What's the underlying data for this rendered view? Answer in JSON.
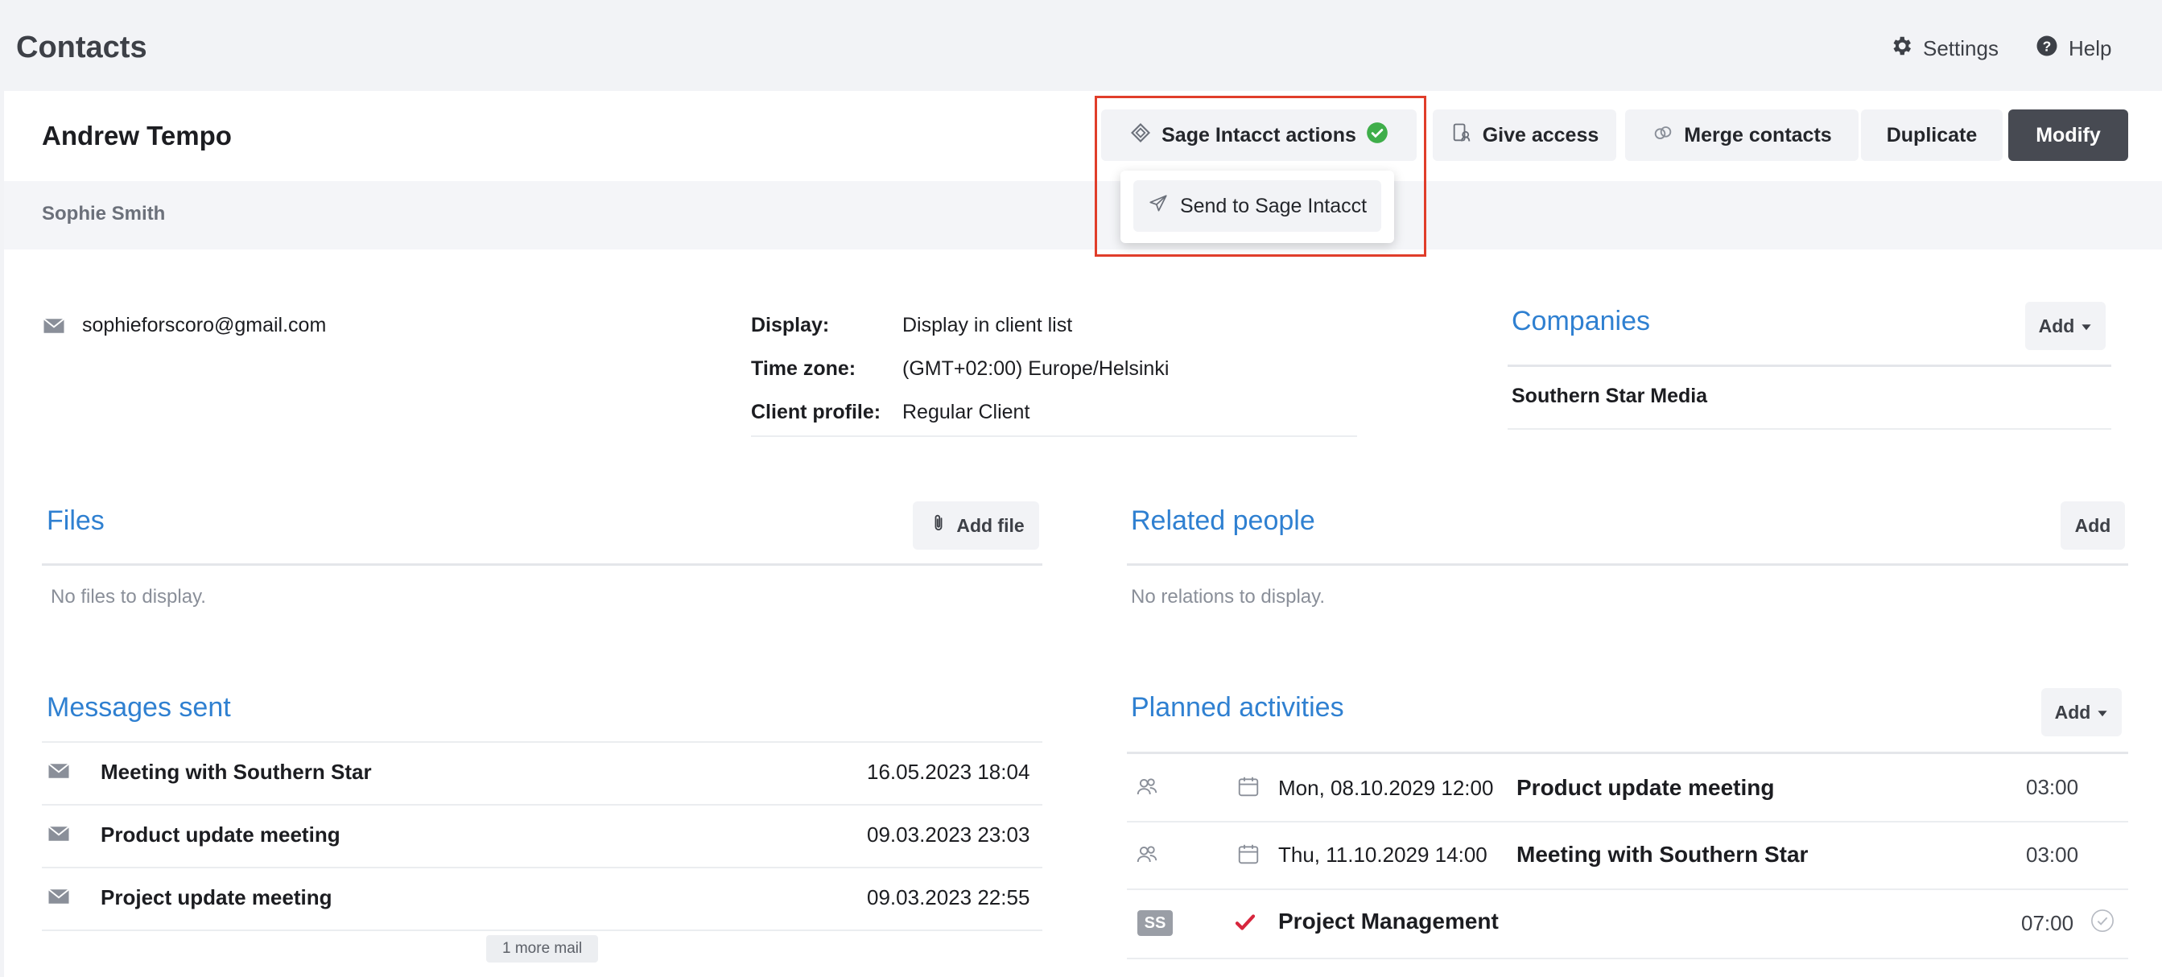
{
  "app": {
    "title": "Contacts"
  },
  "top_links": {
    "settings": "Settings",
    "help": "Help"
  },
  "contact": {
    "name": "Andrew Tempo",
    "sub_name": "Sophie Smith"
  },
  "actions": {
    "sage": "Sage Intacct actions",
    "give_access": "Give access",
    "merge": "Merge contacts",
    "duplicate": "Duplicate",
    "modify": "Modify"
  },
  "dropdown": {
    "send": "Send to Sage Intacct"
  },
  "email": "sophieforscoro@gmail.com",
  "details": [
    {
      "label": "Display:",
      "value": "Display in client list"
    },
    {
      "label": "Time zone:",
      "value": "(GMT+02:00) Europe/Helsinki"
    },
    {
      "label": "Client profile:",
      "value": "Regular Client"
    }
  ],
  "companies": {
    "title": "Companies",
    "add": "Add",
    "items": [
      "Southern Star Media"
    ]
  },
  "files": {
    "title": "Files",
    "add": "Add file",
    "empty": "No files to display."
  },
  "related": {
    "title": "Related people",
    "add": "Add",
    "empty": "No relations to display."
  },
  "messages": {
    "title": "Messages sent",
    "items": [
      {
        "subject": "Meeting with Southern Star",
        "date": "16.05.2023 18:04"
      },
      {
        "subject": "Product update meeting",
        "date": "09.03.2023 23:03"
      },
      {
        "subject": "Project update meeting",
        "date": "09.03.2023 22:55"
      }
    ],
    "more": "1 more mail"
  },
  "activities": {
    "title": "Planned activities",
    "add": "Add",
    "items": [
      {
        "date": "Mon, 08.10.2029 12:00",
        "title": "Product update meeting",
        "duration": "03:00"
      },
      {
        "date": "Thu, 11.10.2029 14:00",
        "title": "Meeting with Southern Star",
        "duration": "03:00"
      },
      {
        "badge": "SS",
        "title": "Project Management",
        "duration": "07:00"
      }
    ]
  },
  "colors": {
    "accent": "#2f80d1",
    "highlight": "#e03d2a",
    "success": "#3fae4a",
    "task_check": "#d7263d",
    "dark_button": "#474a52"
  }
}
